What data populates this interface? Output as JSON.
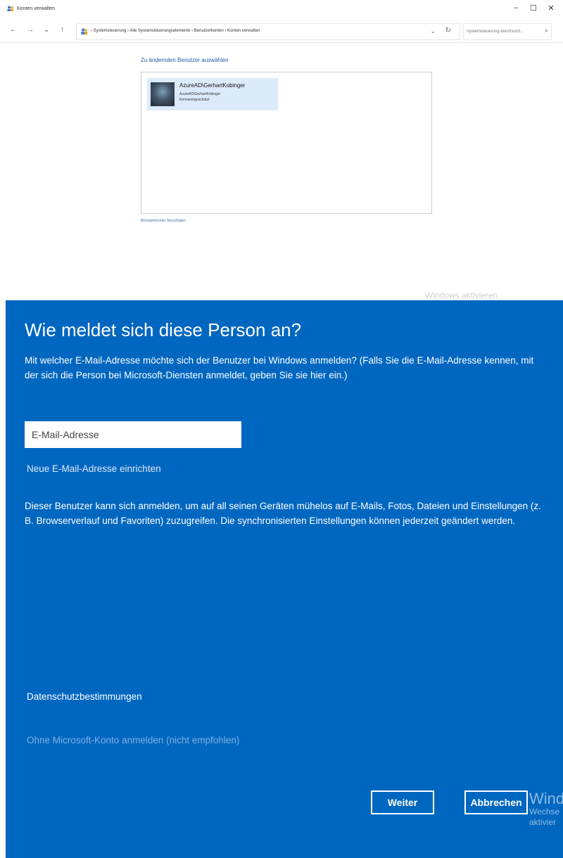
{
  "window": {
    "title": "Konten verwalten",
    "minimize": "–",
    "maximize": "☐",
    "close": "✕"
  },
  "address_bar": {
    "nav_back": "←",
    "nav_forward": "→",
    "nav_recent": "⌄",
    "nav_up": "↑",
    "breadcrumbs": "› Systemsteuerung  ›  Alle Systemsteuerungselemente  ›  Benutzerkonten  ›  Konten verwalten",
    "dropdown": "⌄",
    "refresh": "↻"
  },
  "search": {
    "placeholder": "Systemsteuerung durchsuch...",
    "icon": "⌕"
  },
  "content": {
    "heading": "Zu ändernden Benutzer auswählen",
    "users": [
      {
        "name": "AzureAD\\GerhartKobinger",
        "subtitle": "AzureAD\\GerhartKobinger",
        "status": "Kennwortgeschützt"
      }
    ],
    "add_account_link": "Benutzerkonto hinzufügen",
    "watermark": "Windows aktivieren"
  },
  "dialog": {
    "title": "Wie meldet sich diese Person an?",
    "description": "Mit welcher E-Mail-Adresse möchte sich der Benutzer bei Windows anmelden? (Falls Sie die E-Mail-Adresse kennen, mit der sich die Person bei Microsoft-Diensten anmeldet, geben Sie sie hier ein.)",
    "email_placeholder": "E-Mail-Adresse",
    "new_email_link": "Neue E-Mail-Adresse einrichten",
    "info": "Dieser Benutzer kann sich anmelden, um auf all seinen Geräten mühelos auf E-Mails, Fotos, Dateien und Einstellungen (z. B. Browserverlauf und Favoriten) zuzugreifen. Die synchronisierten Einstellungen können jederzeit geändert werden.",
    "privacy_link": "Datenschutzbestimmungen",
    "no_ms_account_link": "Ohne Microsoft-Konto anmelden (nicht empfohlen)",
    "next_button": "Weiter",
    "cancel_button": "Abbrechen",
    "watermark_big": "Wind",
    "watermark_line2": "Wechse",
    "watermark_line3": "aktivier"
  },
  "colors": {
    "dialog_bg": "#0067c0",
    "link_blue": "#1e5aa8",
    "selection": "#dcebfa"
  }
}
